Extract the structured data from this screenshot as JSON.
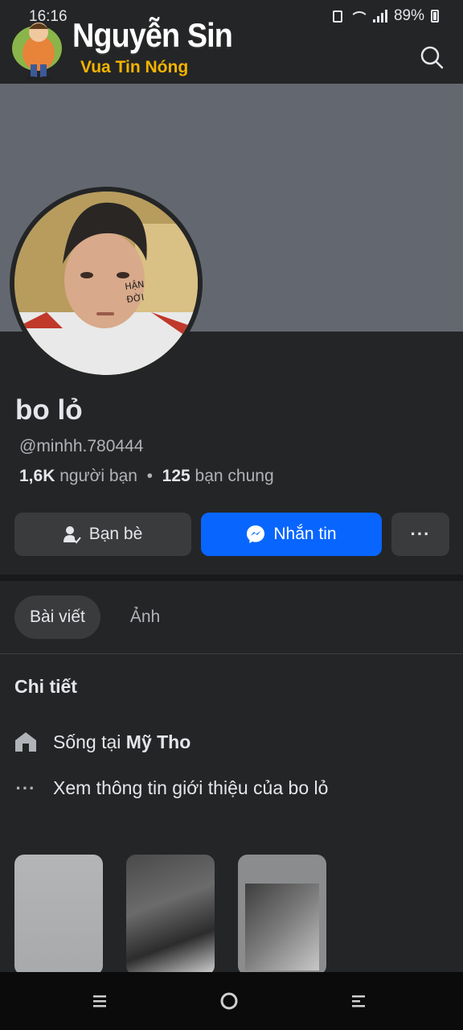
{
  "status_bar": {
    "time": "16:16",
    "app_icons": [
      "M",
      "Zalo",
      "img"
    ],
    "battery": "89%"
  },
  "watermark": {
    "title": "Nguyễn Sin",
    "subtitle": "Vua Tin Nóng"
  },
  "profile": {
    "name": "bo lỏ",
    "username": "@minhh.780444",
    "avatar_text": "HẬN ĐỜI",
    "friends_count": "1,6K",
    "friends_label": "người bạn",
    "mutual_count": "125",
    "mutual_label": "bạn chung"
  },
  "actions": {
    "friends_label": "Bạn bè",
    "message_label": "Nhắn tin",
    "more_label": "···"
  },
  "tabs": [
    {
      "label": "Bài viết",
      "active": true
    },
    {
      "label": "Ảnh",
      "active": false
    }
  ],
  "details": {
    "title": "Chi tiết",
    "lives_in_prefix": "Sống tại",
    "lives_in_place": "Mỹ Tho",
    "about_link": "Xem thông tin giới thiệu của bo lỏ"
  },
  "colors": {
    "background": "#242526",
    "cover": "#636870",
    "accent": "#0866ff",
    "button": "#3a3b3c",
    "watermark_sub": "#f4b400"
  },
  "icons": {
    "search": "search-icon",
    "home": "house-icon",
    "more": "more-dots-icon",
    "messenger": "messenger-icon",
    "friend": "friend-check-icon"
  }
}
